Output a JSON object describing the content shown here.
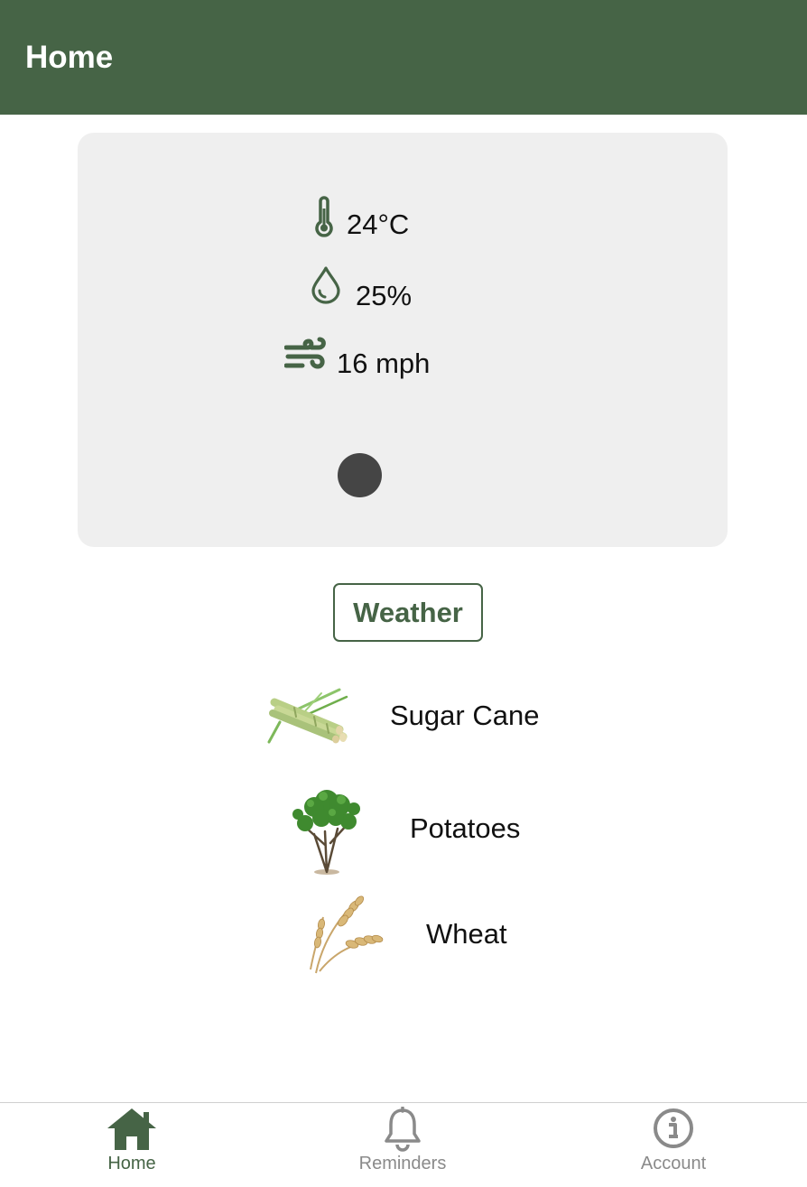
{
  "header": {
    "title": "Home"
  },
  "weather": {
    "temperature": "24°C",
    "humidity": "25%",
    "wind_speed": "16 mph",
    "icons": [
      "thermometer-icon",
      "water-drop-icon",
      "wind-icon"
    ],
    "button_label": "Weather"
  },
  "crops": [
    {
      "name": "Sugar Cane",
      "image": "sugar-cane-image"
    },
    {
      "name": "Potatoes",
      "image": "potato-plant-image"
    },
    {
      "name": "Wheat",
      "image": "wheat-image"
    }
  ],
  "tabs": [
    {
      "label": "Home",
      "icon": "home-icon",
      "active": true
    },
    {
      "label": "Reminders",
      "icon": "bell-icon",
      "active": false
    },
    {
      "label": "Account",
      "icon": "info-icon",
      "active": false
    }
  ],
  "colors": {
    "brand_green": "#466446",
    "card_background": "#efefef",
    "inactive_tab": "#8a8a8a",
    "loader_dot": "#454545"
  }
}
